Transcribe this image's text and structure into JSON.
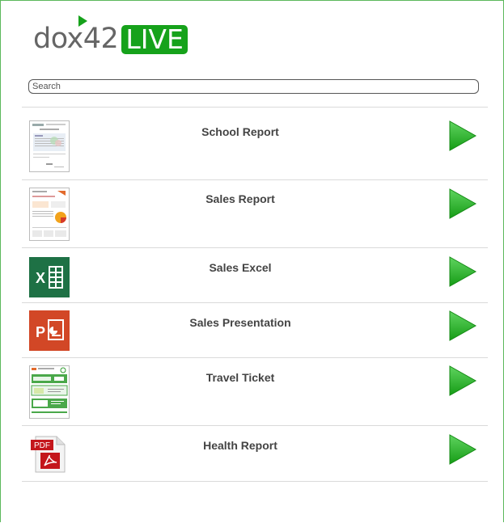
{
  "app": {
    "logo_text": "dox42",
    "logo_badge": "LIVE",
    "brand_color": "#16a21b"
  },
  "search": {
    "placeholder": "Search",
    "value": ""
  },
  "documents": [
    {
      "title": "School Report",
      "icon": "document-preview-icon",
      "action": "play-icon"
    },
    {
      "title": "Sales Report",
      "icon": "document-preview-icon",
      "action": "play-icon"
    },
    {
      "title": "Sales Excel",
      "icon": "excel-icon",
      "action": "play-icon"
    },
    {
      "title": "Sales Presentation",
      "icon": "powerpoint-icon",
      "action": "play-icon"
    },
    {
      "title": "Travel Ticket",
      "icon": "document-preview-icon",
      "action": "play-icon"
    },
    {
      "title": "Health Report",
      "icon": "pdf-icon",
      "action": "play-icon"
    }
  ],
  "icons": {
    "excel_letter": "X",
    "powerpoint_letter": "P",
    "pdf_label": "PDF"
  }
}
